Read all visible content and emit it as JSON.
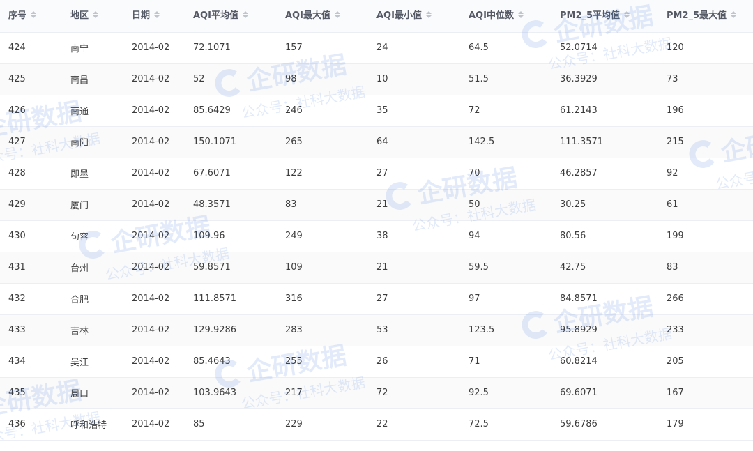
{
  "table": {
    "columns": [
      {
        "key": "idx",
        "label": "序号"
      },
      {
        "key": "region",
        "label": "地区"
      },
      {
        "key": "date",
        "label": "日期"
      },
      {
        "key": "aqi_avg",
        "label": "AQI平均值"
      },
      {
        "key": "aqi_max",
        "label": "AQI最大值"
      },
      {
        "key": "aqi_min",
        "label": "AQI最小值"
      },
      {
        "key": "aqi_median",
        "label": "AQI中位数"
      },
      {
        "key": "pm25_avg",
        "label": "PM2_5平均值"
      },
      {
        "key": "pm25_max",
        "label": "PM2_5最大值"
      }
    ],
    "rows": [
      [
        "424",
        "南宁",
        "2014-02",
        "72.1071",
        "157",
        "24",
        "64.5",
        "52.0714",
        "120"
      ],
      [
        "425",
        "南昌",
        "2014-02",
        "52",
        "98",
        "10",
        "51.5",
        "36.3929",
        "73"
      ],
      [
        "426",
        "南通",
        "2014-02",
        "85.6429",
        "246",
        "35",
        "72",
        "61.2143",
        "196"
      ],
      [
        "427",
        "南阳",
        "2014-02",
        "150.1071",
        "265",
        "64",
        "142.5",
        "111.3571",
        "215"
      ],
      [
        "428",
        "即墨",
        "2014-02",
        "67.6071",
        "122",
        "27",
        "70",
        "46.2857",
        "92"
      ],
      [
        "429",
        "厦门",
        "2014-02",
        "48.3571",
        "83",
        "21",
        "50",
        "30.25",
        "61"
      ],
      [
        "430",
        "句容",
        "2014-02",
        "109.96",
        "249",
        "38",
        "94",
        "80.56",
        "199"
      ],
      [
        "431",
        "台州",
        "2014-02",
        "59.8571",
        "109",
        "21",
        "59.5",
        "42.75",
        "83"
      ],
      [
        "432",
        "合肥",
        "2014-02",
        "111.8571",
        "316",
        "27",
        "97",
        "84.8571",
        "266"
      ],
      [
        "433",
        "吉林",
        "2014-02",
        "129.9286",
        "283",
        "53",
        "123.5",
        "95.8929",
        "233"
      ],
      [
        "434",
        "吴江",
        "2014-02",
        "85.4643",
        "255",
        "26",
        "71",
        "60.8214",
        "205"
      ],
      [
        "435",
        "周口",
        "2014-02",
        "103.9643",
        "217",
        "72",
        "92.5",
        "69.6071",
        "167"
      ],
      [
        "436",
        "呼和浩特",
        "2014-02",
        "85",
        "229",
        "22",
        "72.5",
        "59.6786",
        "179"
      ]
    ]
  },
  "watermark": {
    "brand": "企研数据",
    "sub": "公众号：社科大数据",
    "color": "#2f6fe0"
  },
  "icons": {
    "sort": "sort-caret-icon",
    "logo": "qiyan-logo-icon"
  }
}
